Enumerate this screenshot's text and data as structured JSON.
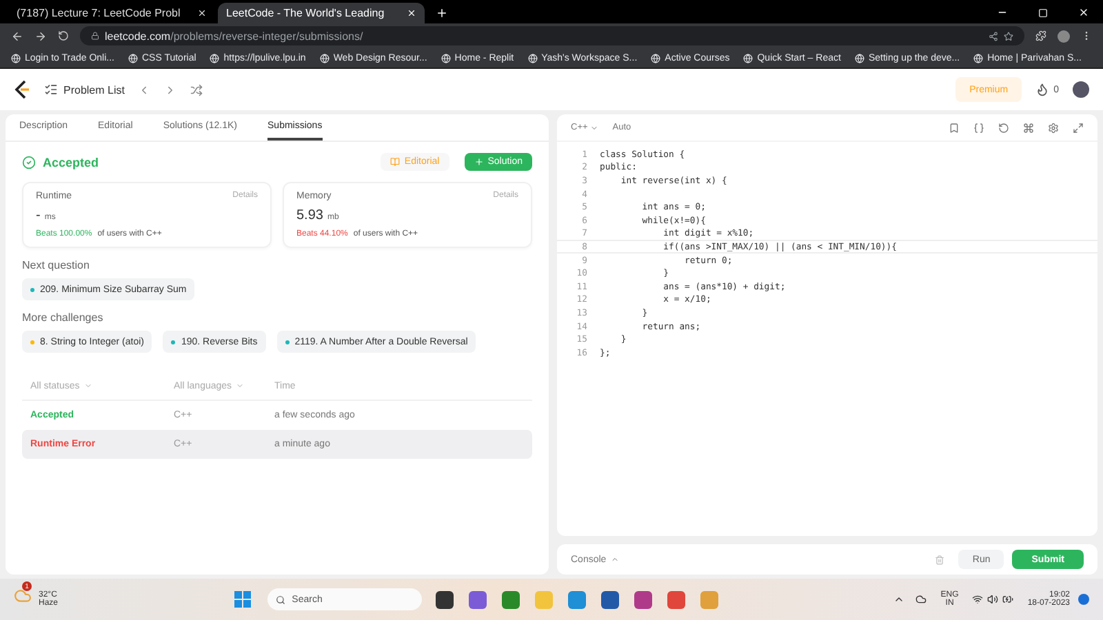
{
  "browser": {
    "tabs": [
      {
        "title": "(7187) Lecture 7: LeetCode Probl",
        "selected": false
      },
      {
        "title": "LeetCode - The World's Leading",
        "selected": true
      }
    ],
    "url_host": "leetcode.com",
    "url_path": "/problems/reverse-integer/submissions/",
    "bookmarks": [
      "Login to Trade Onli...",
      "CSS Tutorial",
      "https://lpulive.lpu.in",
      "Web Design Resour...",
      "Home - Replit",
      "Yash's Workspace S...",
      "Active Courses",
      "Quick Start – React",
      "Setting up the deve...",
      "Home | Parivahan S..."
    ]
  },
  "header": {
    "problem_list": "Problem List",
    "premium": "Premium",
    "streak": "0"
  },
  "tabs": [
    {
      "label": "Description",
      "selected": false
    },
    {
      "label": "Editorial",
      "selected": false
    },
    {
      "label": "Solutions (12.1K)",
      "selected": false
    },
    {
      "label": "Submissions",
      "selected": true
    }
  ],
  "result": {
    "status": "Accepted",
    "editorial_button": "Editorial",
    "solution_button": "Solution"
  },
  "stats": [
    {
      "title": "Runtime",
      "details": "Details",
      "value": "-",
      "unit": "ms",
      "beats": "Beats 100.00%",
      "suffix": "of users with C++",
      "good": true
    },
    {
      "title": "Memory",
      "details": "Details",
      "value": "5.93",
      "unit": "mb",
      "beats": "Beats 44.10%",
      "suffix": "of users with C++",
      "good": false
    }
  ],
  "next_question": {
    "label": "Next question",
    "items": [
      {
        "title": "209. Minimum Size Subarray Sum",
        "color": "#1cb8b8"
      }
    ]
  },
  "more_challenges": {
    "label": "More challenges",
    "items": [
      {
        "title": "8. String to Integer (atoi)",
        "color": "#ffb800"
      },
      {
        "title": "190. Reverse Bits",
        "color": "#1cb8b8"
      },
      {
        "title": "2119. A Number After a Double Reversal",
        "color": "#1cb8b8"
      }
    ]
  },
  "submissions": {
    "columns": [
      "All statuses",
      "All languages",
      "Time"
    ],
    "rows": [
      {
        "status": "Accepted",
        "ok": true,
        "language": "C++",
        "time": "a few seconds ago",
        "selected": false
      },
      {
        "status": "Runtime Error",
        "ok": false,
        "language": "C++",
        "time": "a minute ago",
        "selected": true
      }
    ]
  },
  "editor": {
    "language": "C++",
    "mode": "Auto",
    "lines": [
      {
        "number": "1",
        "text": "class Solution {",
        "current": false
      },
      {
        "number": "2",
        "text": "public:",
        "current": false
      },
      {
        "number": "3",
        "text": "    int reverse(int x) {",
        "current": false
      },
      {
        "number": "4",
        "current": false
      },
      {
        "number": "5",
        "text": "        int ans = 0;",
        "current": false
      },
      {
        "number": "6",
        "text": "        while(x!=0){",
        "current": false
      },
      {
        "number": "7",
        "text": "            int digit = x%10;",
        "current": false
      },
      {
        "number": "8",
        "text": "            if((ans >INT_MAX/10) || (ans < INT_MIN/10)){",
        "current": true
      },
      {
        "number": "9",
        "text": "                return 0;",
        "current": false
      },
      {
        "number": "10",
        "text": "            }",
        "current": false
      },
      {
        "number": "11",
        "text": "            ans = (ans*10) + digit;",
        "current": false
      },
      {
        "number": "12",
        "text": "            x = x/10;",
        "current": false
      },
      {
        "number": "13",
        "text": "        }",
        "current": false
      },
      {
        "number": "14",
        "text": "        return ans;",
        "current": false
      },
      {
        "number": "15",
        "text": "    }",
        "current": false
      },
      {
        "number": "16",
        "text": "};",
        "current": false
      }
    ]
  },
  "console": {
    "label": "Console",
    "run": "Run",
    "submit": "Submit"
  },
  "taskbar": {
    "temperature": "32°C",
    "weather": "Haze",
    "weather_badge": "1",
    "search": "Search",
    "lang_1": "ENG",
    "lang_2": "IN",
    "time": "19:02",
    "date": "18-07-2023"
  }
}
